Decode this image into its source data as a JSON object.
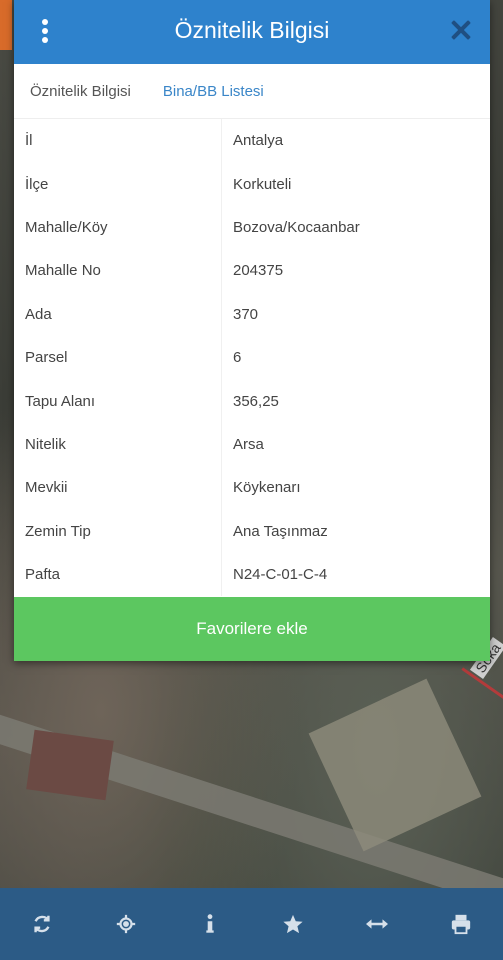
{
  "header": {
    "title": "Öznitelik Bilgisi"
  },
  "tabs": [
    {
      "label": "Öznitelik Bilgisi"
    },
    {
      "label": "Bina/BB Listesi"
    }
  ],
  "attributes": [
    {
      "key": "İl",
      "value": "Antalya"
    },
    {
      "key": "İlçe",
      "value": "Korkuteli"
    },
    {
      "key": "Mahalle/Köy",
      "value": "Bozova/Kocaanbar"
    },
    {
      "key": "Mahalle No",
      "value": "204375"
    },
    {
      "key": "Ada",
      "value": "370"
    },
    {
      "key": "Parsel",
      "value": "6"
    },
    {
      "key": "Tapu Alanı",
      "value": "356,25"
    },
    {
      "key": "Nitelik",
      "value": "Arsa"
    },
    {
      "key": "Mevkii",
      "value": "Köykenarı"
    },
    {
      "key": "Zemin Tip",
      "value": "Ana Taşınmaz"
    },
    {
      "key": "Pafta",
      "value": "N24-C-01-C-4"
    }
  ],
  "favorite_button": {
    "label": "Favorilere ekle"
  },
  "map": {
    "street_label": "Soka"
  },
  "toolbar": {
    "icons": [
      "refresh-icon",
      "locate-icon",
      "info-icon",
      "star-icon",
      "measure-icon",
      "print-icon"
    ]
  }
}
